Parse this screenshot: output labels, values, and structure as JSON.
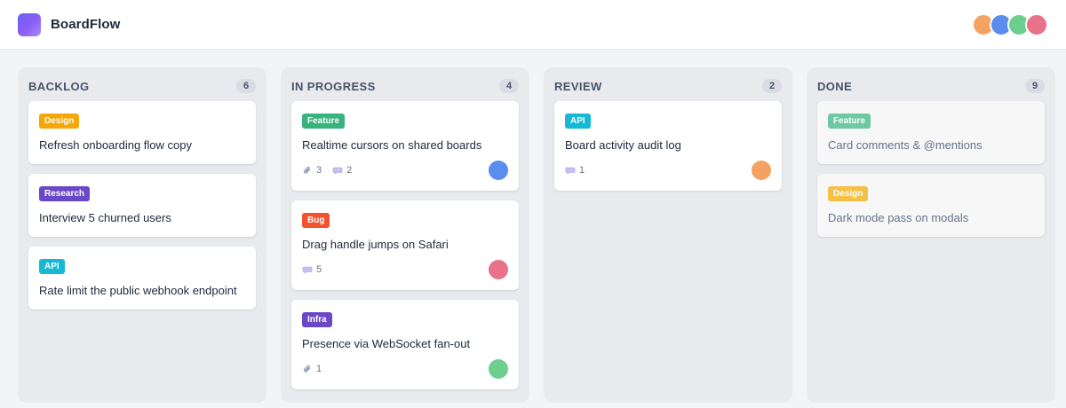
{
  "app": {
    "title": "BoardFlow"
  },
  "header": {
    "avatars": [
      {
        "color": "#f4a261"
      },
      {
        "color": "#5b8def"
      },
      {
        "color": "#6ccf8e"
      },
      {
        "color": "#e8728a"
      }
    ]
  },
  "columns": [
    {
      "title": "BACKLOG",
      "count": "6",
      "cards": [
        {
          "tag": "Design",
          "tag_color": "#f5a70a",
          "title": "Refresh onboarding flow copy"
        },
        {
          "tag": "Research",
          "tag_color": "#6b48c7",
          "title": "Interview 5 churned users"
        },
        {
          "tag": "API",
          "tag_color": "#16b9d4",
          "title": "Rate limit the public webhook endpoint"
        }
      ]
    },
    {
      "title": "IN PROGRESS",
      "count": "4",
      "cards": [
        {
          "tag": "Feature",
          "tag_color": "#37b37e",
          "title": "Realtime cursors on shared boards",
          "attachments": "3",
          "comments": "2",
          "assignee_color": "#5b8def"
        },
        {
          "tag": "Bug",
          "tag_color": "#f0532d",
          "title": "Drag handle jumps on Safari",
          "comments": "5",
          "assignee_color": "#e8728a"
        },
        {
          "tag": "Infra",
          "tag_color": "#6b48c7",
          "title": "Presence via WebSocket fan-out",
          "attachments": "1",
          "assignee_color": "#6ccf8e"
        }
      ]
    },
    {
      "title": "REVIEW",
      "count": "2",
      "cards": [
        {
          "tag": "API",
          "tag_color": "#16b9d4",
          "title": "Board activity audit log",
          "comments": "1",
          "assignee_color": "#f4a261"
        }
      ]
    },
    {
      "title": "DONE",
      "count": "9",
      "cards": [
        {
          "tag": "Feature",
          "tag_color": "#6cc9a1",
          "title": "Card comments & @mentions"
        },
        {
          "tag": "Design",
          "tag_color": "#f4c146",
          "title": "Dark mode pass on modals"
        }
      ]
    }
  ]
}
